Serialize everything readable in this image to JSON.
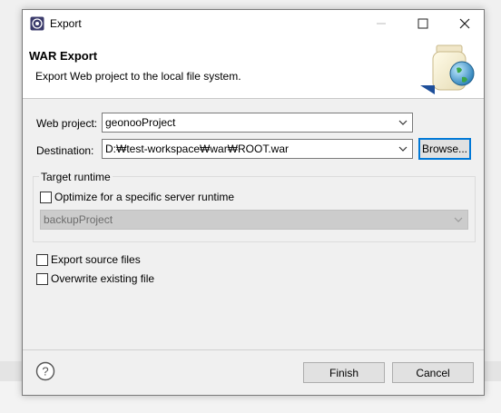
{
  "window": {
    "title": "Export"
  },
  "banner": {
    "title": "WAR Export",
    "description": "Export Web project to the local file system."
  },
  "form": {
    "web_project_label": "Web project:",
    "web_project_value": "geonooProject",
    "destination_label": "Destination:",
    "destination_value": "D:₩test-workspace₩war₩ROOT.war",
    "browse_label": "Browse..."
  },
  "target_runtime": {
    "legend": "Target runtime",
    "optimize_label": "Optimize for a specific server runtime",
    "optimize_checked": false,
    "runtime_value": "backupProject"
  },
  "options": {
    "export_source_label": "Export source files",
    "export_source_checked": false,
    "overwrite_label": "Overwrite existing file",
    "overwrite_checked": false
  },
  "buttons": {
    "finish": "Finish",
    "cancel": "Cancel"
  },
  "icons": [
    "app-icon",
    "minimize-icon",
    "maximize-icon",
    "close-icon",
    "war-export-icon",
    "chevron-down-icon",
    "help-icon"
  ]
}
